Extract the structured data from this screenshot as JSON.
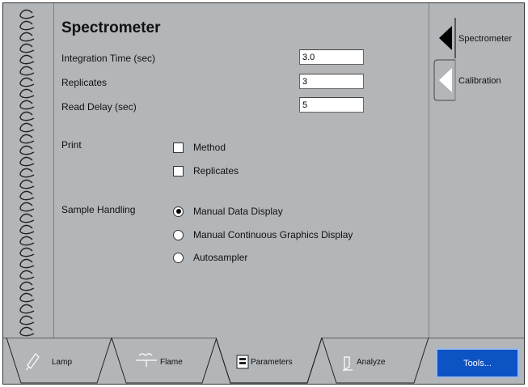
{
  "main": {
    "title": "Spectrometer",
    "fields": [
      {
        "label": "Integration Time (sec)",
        "value": "3.0"
      },
      {
        "label": "Replicates",
        "value": "3"
      },
      {
        "label": "Read Delay (sec)",
        "value": "5"
      }
    ],
    "print": {
      "label": "Print",
      "options": [
        {
          "label": "Method",
          "checked": false
        },
        {
          "label": "Replicates",
          "checked": false
        }
      ]
    },
    "sample_handling": {
      "label": "Sample Handling",
      "options": [
        {
          "label": "Manual Data Display",
          "selected": true
        },
        {
          "label": "Manual Continuous Graphics Display",
          "selected": false
        },
        {
          "label": "Autosampler",
          "selected": false
        }
      ]
    }
  },
  "side_tabs": [
    {
      "label": "Spectrometer",
      "active": true
    },
    {
      "label": "Calibration",
      "active": false
    }
  ],
  "bottom_tabs": [
    {
      "label": "Lamp",
      "icon": "lamp-icon"
    },
    {
      "label": "Flame",
      "icon": "flame-icon"
    },
    {
      "label": "Parameters",
      "icon": "parameters-icon",
      "active": true
    },
    {
      "label": "Analyze",
      "icon": "analyze-icon"
    }
  ],
  "tools_label": "Tools...",
  "colors": {
    "panel": "#b2b6b8",
    "tools_button": "#0c53c4"
  }
}
